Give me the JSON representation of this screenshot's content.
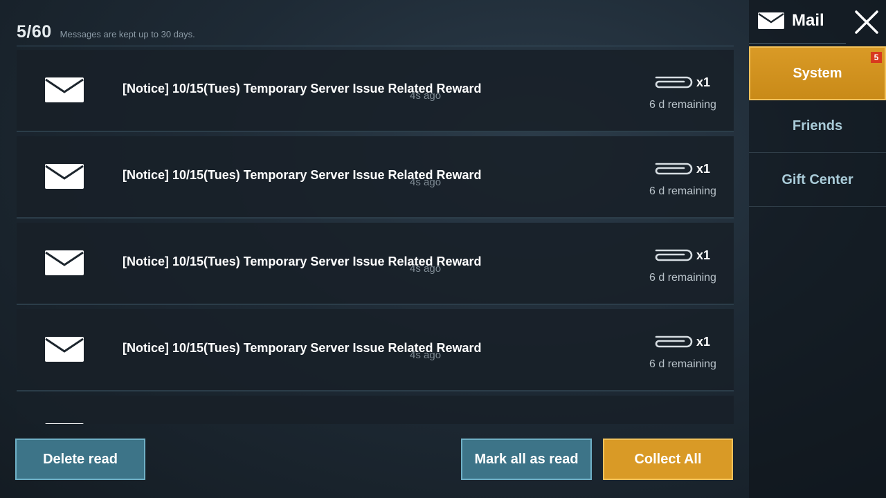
{
  "header": {
    "count": "5/60",
    "retention_note": "Messages are kept up to 30 days."
  },
  "mails": [
    {
      "icon": "envelope-icon",
      "subject": "[Notice] 10/15(Tues) Temporary Server Issue Related Reward",
      "time_ago": "4s ago",
      "attachment_icon": "paperclip-icon",
      "quantity": "x1",
      "remaining": "6 d remaining"
    },
    {
      "icon": "envelope-icon",
      "subject": "[Notice] 10/15(Tues) Temporary Server Issue Related Reward",
      "time_ago": "4s ago",
      "attachment_icon": "paperclip-icon",
      "quantity": "x1",
      "remaining": "6 d remaining"
    },
    {
      "icon": "envelope-icon",
      "subject": "[Notice] 10/15(Tues) Temporary Server Issue Related Reward",
      "time_ago": "4s ago",
      "attachment_icon": "paperclip-icon",
      "quantity": "x1",
      "remaining": "6 d remaining"
    },
    {
      "icon": "envelope-icon",
      "subject": "[Notice] 10/15(Tues) Temporary Server Issue Related Reward",
      "time_ago": "4s ago",
      "attachment_icon": "paperclip-icon",
      "quantity": "x1",
      "remaining": "6 d remaining"
    },
    {
      "icon": "envelope-icon",
      "subject": "",
      "time_ago": "",
      "attachment_icon": "",
      "quantity": "",
      "remaining": ""
    }
  ],
  "buttons": {
    "delete_read": "Delete read",
    "mark_all_read": "Mark all as read",
    "collect_all": "Collect All"
  },
  "sidebar": {
    "title": "Mail",
    "title_icon": "envelope-icon",
    "close_icon": "close-icon",
    "tabs": [
      {
        "label": "System",
        "badge": "5",
        "active": true
      },
      {
        "label": "Friends",
        "active": false
      },
      {
        "label": "Gift Center",
        "active": false
      }
    ]
  },
  "colors": {
    "accent_gold": "#d99a26",
    "button_blue": "#3d7488",
    "badge_red": "#d8391e",
    "row_bg": "#182028"
  }
}
